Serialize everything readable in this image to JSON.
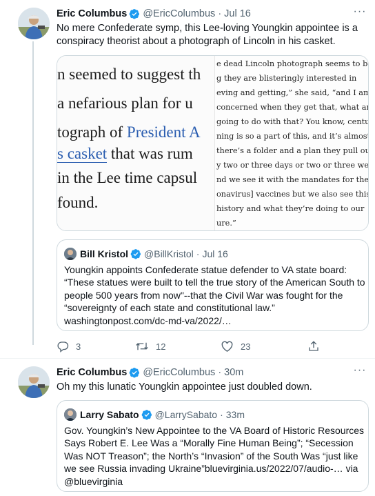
{
  "tweet1": {
    "author_name": "Eric Columbus",
    "handle": "@EricColumbus",
    "separator": "·",
    "time": "Jul 16",
    "more_label": "···",
    "text": "No mere Confederate symp, this Lee-loving Youngkin appointee is a conspiracy theorist about a photograph of Lincoln in his casket.",
    "media": {
      "left_lines": [
        "n seemed to suggest th",
        "a nefarious plan for u",
        "tograph of President A",
        "s casket that was rum",
        "in the Lee time capsul",
        "found."
      ],
      "right_lines": [
        "e dead Lincoln photograph seems to be",
        "g they are blisteringly interested in",
        "eving and getting,” she said, “and I am",
        "concerned when they get that, what ar",
        "going to do with that? You know, centu",
        "ning is so a part of this, and it’s almost",
        "there’s a folder and a plan they pull out",
        "y two or three days or two or three wee",
        "nd we see it with the mandates for the",
        "onavirus] vaccines but we also see this",
        "history and what they’re doing to our",
        "ure.”"
      ]
    },
    "quote": {
      "author_name": "Bill Kristol",
      "handle": "@BillKristol",
      "separator": "·",
      "time": "Jul 16",
      "text": "Youngkin appoints Confederate statue defender to VA state board: “These statues were built to tell the true story of the American South to people 500 years from now\"--that the Civil War was fought for the “sovereignty of each state and constitutional law.” washingtonpost.com/dc-md-va/2022/…"
    },
    "actions": {
      "replies": "3",
      "retweets": "12",
      "likes": "23"
    }
  },
  "tweet2": {
    "author_name": "Eric Columbus",
    "handle": "@EricColumbus",
    "separator": "·",
    "time": "30m",
    "more_label": "···",
    "text": "Oh my this lunatic Youngkin appointee just doubled down.",
    "quote": {
      "author_name": "Larry Sabato",
      "handle": "@LarrySabato",
      "separator": "·",
      "time": "33m",
      "text": "Gov. Youngkin’s New Appointee to the VA Board of Historic Resources Says Robert E. Lee Was a “Morally Fine Human Being”; “Secession Was NOT Treason”;  the North’s “Invasion” of the South Was “just like we see Russia invading Ukraine”bluevirginia.us/2022/07/audio-… via @bluevirginia"
    }
  },
  "colors": {
    "verified": "#1d9bf0",
    "secondary_text": "#536471",
    "border": "#cfd9de"
  },
  "icons": [
    "verified-badge-icon",
    "reply-icon",
    "retweet-icon",
    "like-icon",
    "share-icon",
    "more-icon"
  ]
}
